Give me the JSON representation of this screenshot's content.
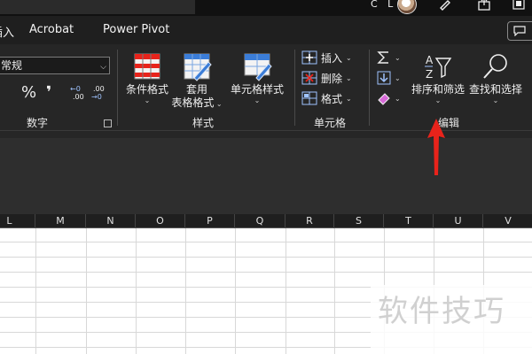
{
  "titlebar": {
    "user_initials": "C L",
    "icons": [
      "avatar",
      "pen-icon",
      "share-icon",
      "collapse-ribbon-icon"
    ]
  },
  "tabs": [
    {
      "label": "插入"
    },
    {
      "label": "Acrobat"
    },
    {
      "label": "Power Pivot"
    }
  ],
  "ribbon": {
    "number_group": {
      "format_value": "常规",
      "currency_symbol": "¥",
      "percent_symbol": "%",
      "comma_symbol": "❜",
      "increase_decimal": "←0 .00",
      "decrease_decimal": ".00 →0",
      "label": "数字"
    },
    "styles_group": {
      "conditional_format": "条件格式",
      "format_as_table_line1": "套用",
      "format_as_table_line2": "表格格式",
      "cell_styles": "单元格样式",
      "label": "样式"
    },
    "cells_group": {
      "insert": "插入",
      "delete": "删除",
      "format": "格式",
      "label": "单元格"
    },
    "editing_group": {
      "sort_filter": "排序和筛选",
      "find_select": "查找和选择",
      "label": "编辑"
    }
  },
  "columns": [
    "L",
    "M",
    "N",
    "O",
    "P",
    "Q",
    "R",
    "S",
    "T",
    "U",
    "V"
  ],
  "watermark": "软件技巧",
  "colors": {
    "ribbon_bg": "#262626",
    "accent_red": "#e8231b"
  }
}
